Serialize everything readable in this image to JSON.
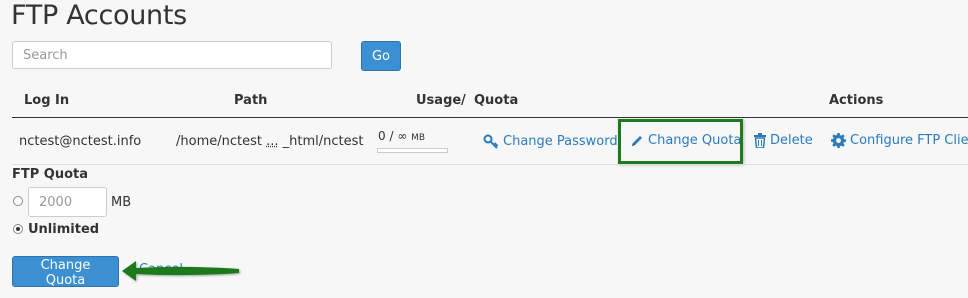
{
  "page": {
    "title": "FTP Accounts"
  },
  "search": {
    "placeholder": "Search",
    "go_label": "Go"
  },
  "table": {
    "headers": {
      "login": "Log In",
      "path": "Path",
      "usage": "Usage",
      "separator": "/",
      "quota": "Quota",
      "actions": "Actions"
    },
    "row": {
      "login": "nctest@nctest.info",
      "path_start": "/home/nctest",
      "path_ellipsis": "...",
      "path_end": "_html/nctest",
      "usage_value": "0 /",
      "usage_infinity": "∞",
      "usage_unit": "MB",
      "usage_fraction": 0,
      "actions": {
        "change_password": "Change Password",
        "change_quota": "Change Quota",
        "delete": "Delete",
        "configure": "Configure FTP Client"
      }
    }
  },
  "quota_form": {
    "label": "FTP Quota",
    "input_placeholder": "2000",
    "unit": "MB",
    "unlimited_label": "Unlimited",
    "selected_option": "Unlimited",
    "submit_label": "Change Quota",
    "cancel_label": "Cancel"
  },
  "colors": {
    "primary_button": "#3c8fd1",
    "link": "#2b7bbd",
    "highlight": "#1e7a1e",
    "background": "#f7f7f7"
  }
}
